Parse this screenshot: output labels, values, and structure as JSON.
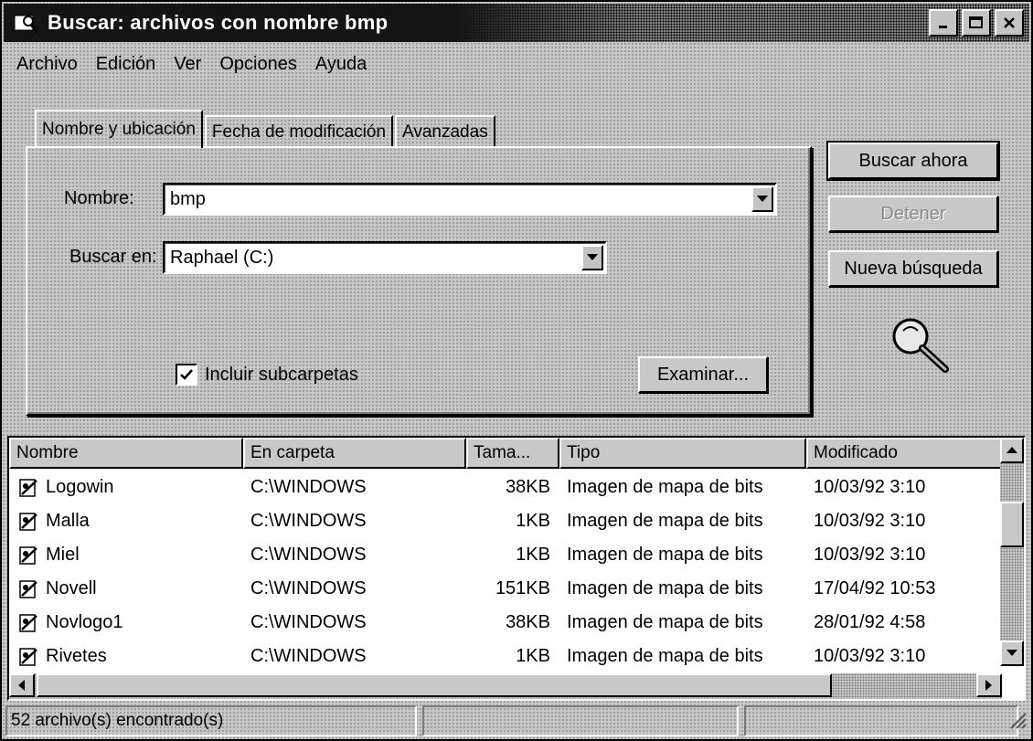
{
  "window": {
    "title": "Buscar: archivos con nombre bmp"
  },
  "menubar": {
    "items": [
      {
        "label": "Archivo"
      },
      {
        "label": "Edición"
      },
      {
        "label": "Ver"
      },
      {
        "label": "Opciones"
      },
      {
        "label": "Ayuda"
      }
    ]
  },
  "tabs": [
    {
      "label": "Nombre y ubicación",
      "active": true
    },
    {
      "label": "Fecha de modificación",
      "active": false
    },
    {
      "label": "Avanzadas",
      "active": false
    }
  ],
  "form": {
    "nombre_label": "Nombre:",
    "nombre_value": "bmp",
    "buscar_en_label": "Buscar en:",
    "buscar_en_value": "Raphael (C:)",
    "incluir_label": "Incluir subcarpetas",
    "incluir_checked": true,
    "examinar_label": "Examinar..."
  },
  "actions": {
    "buscar_ahora": "Buscar ahora",
    "detener": "Detener",
    "nueva_busqueda": "Nueva búsqueda"
  },
  "results": {
    "columns": [
      "Nombre",
      "En carpeta",
      "Tama...",
      "Tipo",
      "Modificado"
    ],
    "rows": [
      {
        "nombre": "Logowin",
        "carpeta": "C:\\WINDOWS",
        "tamano": "38KB",
        "tipo": "Imagen de mapa de bits",
        "modificado": "10/03/92 3:10"
      },
      {
        "nombre": "Malla",
        "carpeta": "C:\\WINDOWS",
        "tamano": "1KB",
        "tipo": "Imagen de mapa de bits",
        "modificado": "10/03/92 3:10"
      },
      {
        "nombre": "Miel",
        "carpeta": "C:\\WINDOWS",
        "tamano": "1KB",
        "tipo": "Imagen de mapa de bits",
        "modificado": "10/03/92 3:10"
      },
      {
        "nombre": "Novell",
        "carpeta": "C:\\WINDOWS",
        "tamano": "151KB",
        "tipo": "Imagen de mapa de bits",
        "modificado": "17/04/92 10:53"
      },
      {
        "nombre": "Novlogo1",
        "carpeta": "C:\\WINDOWS",
        "tamano": "38KB",
        "tipo": "Imagen de mapa de bits",
        "modificado": "28/01/92 4:58"
      },
      {
        "nombre": "Rivetes",
        "carpeta": "C:\\WINDOWS",
        "tamano": "1KB",
        "tipo": "Imagen de mapa de bits",
        "modificado": "10/03/92 3:10"
      }
    ]
  },
  "status": {
    "text": "52 archivo(s) encontrado(s)"
  },
  "icons": {
    "window": "search-window-icon",
    "file": "bitmap-file-icon",
    "animation": "magnifier-icon"
  }
}
